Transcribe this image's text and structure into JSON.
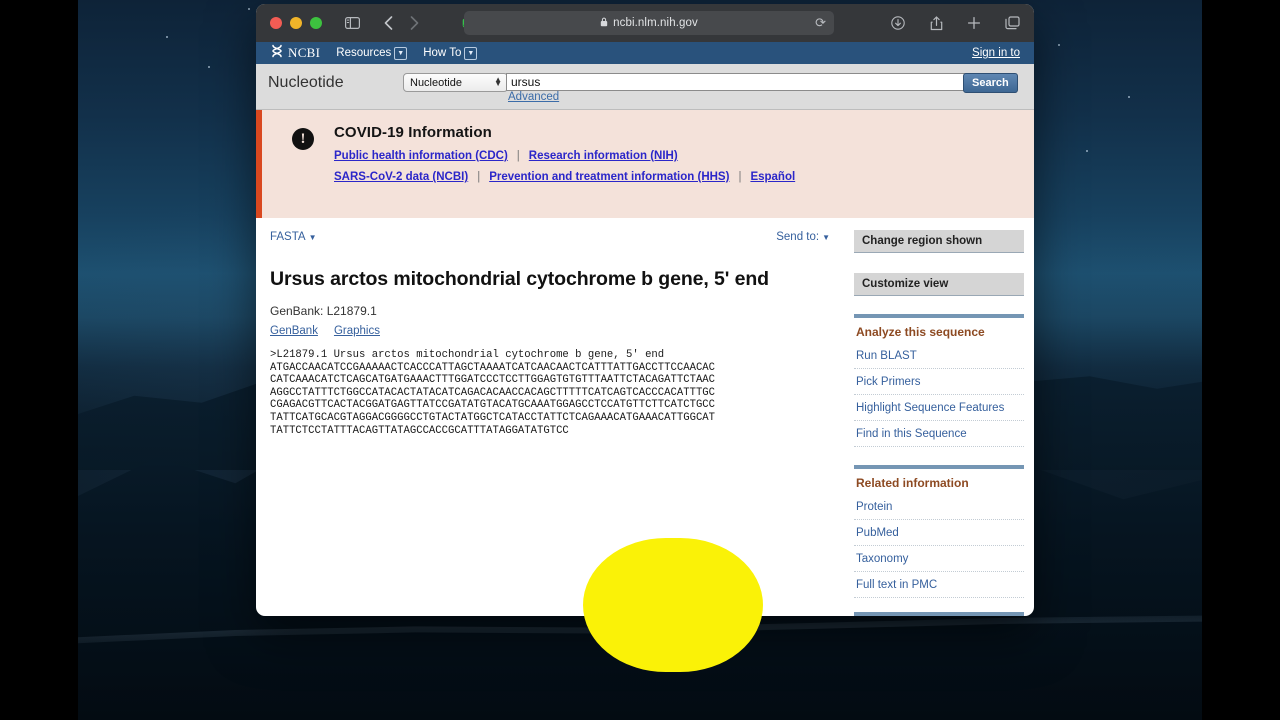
{
  "browser": {
    "traffic_lights": [
      "close",
      "minimize",
      "maximize"
    ],
    "url": "ncbi.nlm.nih.gov",
    "lock_icon": "lock-icon",
    "reload_icon": "reload-icon",
    "sidebar_icon": "sidebar-toggle-icon",
    "back_icon": "chevron-left-icon",
    "forward_icon": "chevron-right-icon",
    "extensions": [
      "evernote-extension-icon",
      "shield-extension-icon"
    ],
    "right_icons": [
      "downloads-icon",
      "share-icon",
      "new-tab-icon",
      "tab-overview-icon"
    ]
  },
  "ncbi_header": {
    "wordmark": "NCBI",
    "logo_icon": "ncbi-dna-logo-icon",
    "menus": [
      {
        "label": "Resources",
        "caret": "⌵"
      },
      {
        "label": "How To",
        "caret": "⌵"
      }
    ],
    "sign_in": "Sign in to"
  },
  "search": {
    "database_title": "Nucleotide",
    "database_selected": "Nucleotide",
    "query_value": "ursus",
    "query_placeholder": "",
    "search_button": "Search",
    "advanced_link": "Advanced"
  },
  "covid": {
    "title": "COVID-19 Information",
    "icon": "exclamation-circle-icon",
    "row1": [
      "Public health information (CDC)",
      "Research information (NIH)"
    ],
    "row2": [
      "SARS-CoV-2 data (NCBI)",
      "Prevention and treatment information (HHS)",
      "Español"
    ],
    "separator": "|",
    "accent_color": "#d9481f",
    "background_color": "#f4e2da"
  },
  "record": {
    "format_menu": "FASTA",
    "send_to": "Send to:",
    "title": "Ursus arctos mitochondrial cytochrome b gene, 5' end",
    "accession": "GenBank: L21879.1",
    "links": [
      "GenBank",
      "Graphics"
    ],
    "fasta_header": ">L21879.1 Ursus arctos mitochondrial cytochrome b gene, 5' end",
    "fasta_lines": [
      "ATGACCAACATCCGAAAAACTCACCCATTAGCTAAAATCATCAACAACTCATTTATTGACCTTCCAACAC",
      "CATCAAACATCTCAGCATGATGAAACTTTGGATCCCTCCTTGGAGTGTGTTTAATTCTACAGATTCTAAC",
      "AGGCCTATTTCTGGCCATACACTATACATCAGACACAACCACAGCTTTTTCATCAGTCACCCACATTTGC",
      "CGAGACGTTCACTACGGATGAGTTATCCGATATGTACATGCAAATGGAGCCTCCATGTTCTTCATCTGCC",
      "TATTCATGCACGTAGGACGGGGCCTGTACTATGGCTCATACCTATTCTCAGAAACATGAAACATTGGCAT",
      "TATTCTCCTATTTACAGTTATAGCCACCGCATTTATAGGATATGTCC"
    ]
  },
  "rail": {
    "bars": [
      "Change region shown",
      "Customize view"
    ],
    "sections": [
      {
        "heading": "Analyze this sequence",
        "items": [
          "Run BLAST",
          "Pick Primers",
          "Highlight Sequence Features",
          "Find in this Sequence"
        ]
      },
      {
        "heading": "Related information",
        "items": [
          "Protein",
          "PubMed",
          "Taxonomy",
          "Full text in PMC"
        ]
      }
    ]
  },
  "overlay": {
    "highlight_color": "#faf207",
    "shape": "rounded-blob"
  }
}
